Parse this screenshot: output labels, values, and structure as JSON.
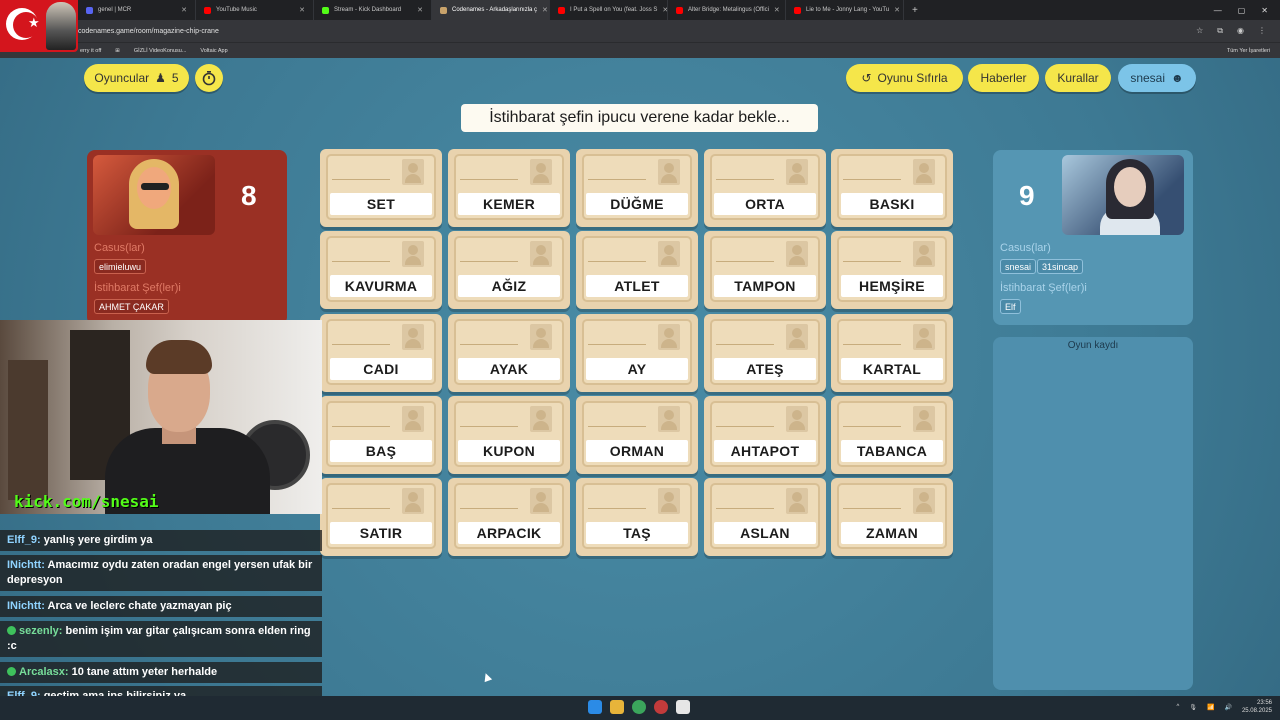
{
  "browser": {
    "tabs": [
      {
        "title": "genel | MCR",
        "active": false,
        "color": "#5865f2"
      },
      {
        "title": "YouTube Music",
        "active": false,
        "color": "#ff0000"
      },
      {
        "title": "Stream - Kick Dashboard",
        "active": false,
        "color": "#53fc18"
      },
      {
        "title": "Codenames - Arkadaşlarınızla ç",
        "active": true,
        "color": "#c9a36b"
      },
      {
        "title": "I Put a Spell on You (feat. Joss S",
        "active": false,
        "color": "#ff0000"
      },
      {
        "title": "Alter Bridge: Metalingus (Offici",
        "active": false,
        "color": "#ff0000"
      },
      {
        "title": "Lie to Me - Jonny Lang - YouTu",
        "active": false,
        "color": "#ff0000"
      }
    ],
    "url": "codenames.game/room/magazine-chip-crane",
    "bookmarks": [
      "erry it off",
      "GİZLİ VideoKonusu...",
      "Voltaic App"
    ],
    "bookmarks_right": "Tüm Yer İşaretleri"
  },
  "game": {
    "players_label": "Oyuncular",
    "players_count": "5",
    "reset_label": "Oyunu Sıfırla",
    "news_label": "Haberler",
    "rules_label": "Kurallar",
    "user_label": "snesai",
    "hint_banner": "İstihbarat şefin ipucu verene kadar bekle...",
    "red": {
      "score": "8",
      "operatives_label": "Casus(lar)",
      "operatives": [
        "elimieluwu"
      ],
      "spymasters_label": "İstihbarat Şef(ler)i",
      "spymasters": [
        "AHMET ÇAKAR"
      ]
    },
    "blue": {
      "score": "9",
      "operatives_label": "Casus(lar)",
      "operatives": [
        "snesai",
        "31sincap"
      ],
      "spymasters_label": "İstihbarat Şef(ler)i",
      "spymasters": [
        "Elf"
      ]
    },
    "log_title": "Oyun kaydı",
    "cards": [
      "SET",
      "KEMER",
      "DÜĞME",
      "ORTA",
      "BASKI",
      "KAVURMA",
      "AĞIZ",
      "ATLET",
      "TAMPON",
      "HEMŞİRE",
      "CADI",
      "AYAK",
      "AY",
      "ATEŞ",
      "KARTAL",
      "BAŞ",
      "KUPON",
      "ORMAN",
      "AHTAPOT",
      "TABANCA",
      "SATIR",
      "ARPACIK",
      "TAŞ",
      "ASLAN",
      "ZAMAN"
    ]
  },
  "stream": {
    "kick_url": "kick.com/snesai",
    "chat": [
      {
        "user": "Elff_9:",
        "text": "yanlış yere girdim ya",
        "badge": false
      },
      {
        "user": "INichtt:",
        "text": "Amacımız oydu zaten oradan engel yersen ufak bir depresyon",
        "badge": false
      },
      {
        "user": "INichtt:",
        "text": "Arca ve leclerc chate yazmayan piç",
        "badge": false
      },
      {
        "user": "sezenly:",
        "text": "benim işim var gitar çalışıcam sonra elden ring :c",
        "badge": true
      },
      {
        "user": "Arcalasx:",
        "text": "10 tane attım yeter herhalde",
        "badge": true
      },
      {
        "user": "Elff_9:",
        "text": "geçtim ama inş bilirsiniz ya",
        "badge": false
      }
    ]
  },
  "taskbar": {
    "time": "23:56",
    "date": "25.08.2025"
  }
}
